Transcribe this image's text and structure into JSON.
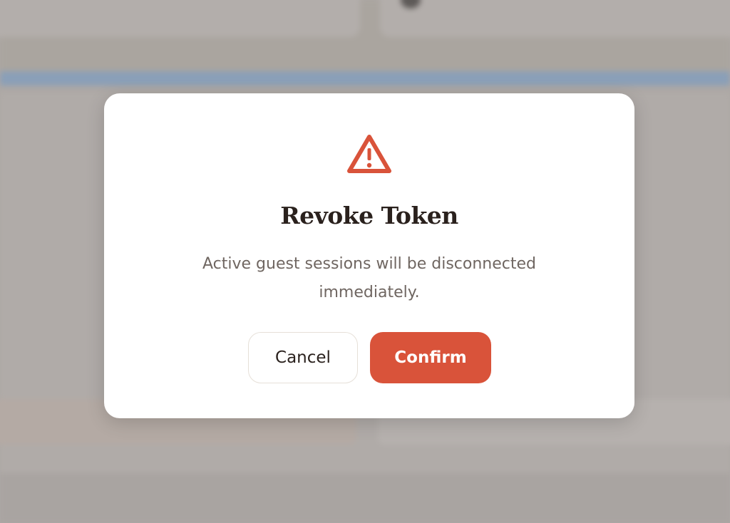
{
  "dialog": {
    "icon": "warning-icon",
    "title": "Revoke Token",
    "message": "Active guest sessions will be disconnected immediately.",
    "cancel_label": "Cancel",
    "confirm_label": "Confirm"
  },
  "colors": {
    "accent": "#d9533a",
    "title_text": "#2a211d",
    "body_text": "#6f6661",
    "overlay": "#ada8a5",
    "dialog_background": "#ffffff"
  }
}
